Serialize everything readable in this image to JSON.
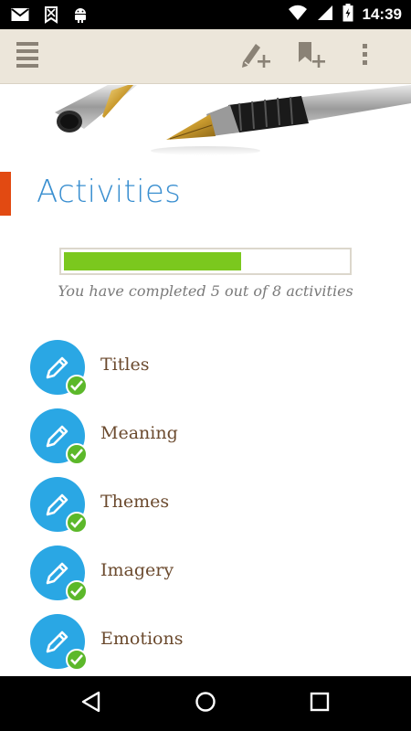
{
  "status_bar": {
    "time": "14:39",
    "icons": [
      "gmail-icon",
      "shield-icon",
      "android-icon",
      "wifi-icon",
      "signal-icon",
      "battery-charging-icon"
    ]
  },
  "toolbar": {
    "menu_icon": "menu-icon",
    "actions": [
      "edit-add-icon",
      "bookmark-add-icon",
      "overflow-menu-icon"
    ]
  },
  "header_image": "fountain-pen-image",
  "page": {
    "title": "Activities"
  },
  "progress": {
    "completed": 5,
    "total": 8,
    "fraction": 0.625,
    "text": "You have completed 5 out of 8 activities",
    "color": "#7bc81e"
  },
  "activities": [
    {
      "label": "Titles",
      "completed": true
    },
    {
      "label": "Meaning",
      "completed": true
    },
    {
      "label": "Themes",
      "completed": true
    },
    {
      "label": "Imagery",
      "completed": true
    },
    {
      "label": "Emotions",
      "completed": true
    }
  ],
  "colors": {
    "title": "#3a8fd0",
    "accent": "#e24a12",
    "activity_icon": "#2aa7e4",
    "check": "#5cb82a",
    "label": "#6b4a2e",
    "toolbar": "#ece6da"
  },
  "nav_bar": [
    "back-icon",
    "home-icon",
    "recents-icon"
  ]
}
